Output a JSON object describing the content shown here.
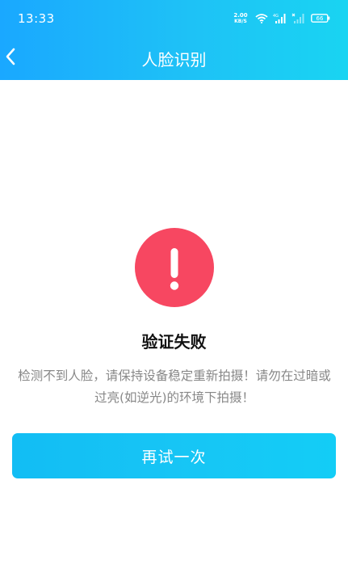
{
  "status_bar": {
    "time": "13:33",
    "net_speed_value": "2.00",
    "net_speed_unit": "KB/S",
    "signal_label": "4G",
    "battery": "66",
    "icons": [
      "wifi-icon",
      "signal-icon",
      "signal-icon",
      "battery-icon"
    ]
  },
  "nav": {
    "title": "人脸识别",
    "back_icon": "chevron-left-icon"
  },
  "result": {
    "icon": "exclamation-icon",
    "icon_color": "#f74761",
    "title": "验证失败",
    "description": "检测不到人脸，请保持设备稳定重新拍摄！请勿在过暗或过亮(如逆光)的环境下拍摄！"
  },
  "actions": {
    "retry_label": "再试一次"
  },
  "colors": {
    "header_gradient_start": "#1aa8ff",
    "header_gradient_end": "#19d4f2",
    "button": "#17c5f5"
  }
}
